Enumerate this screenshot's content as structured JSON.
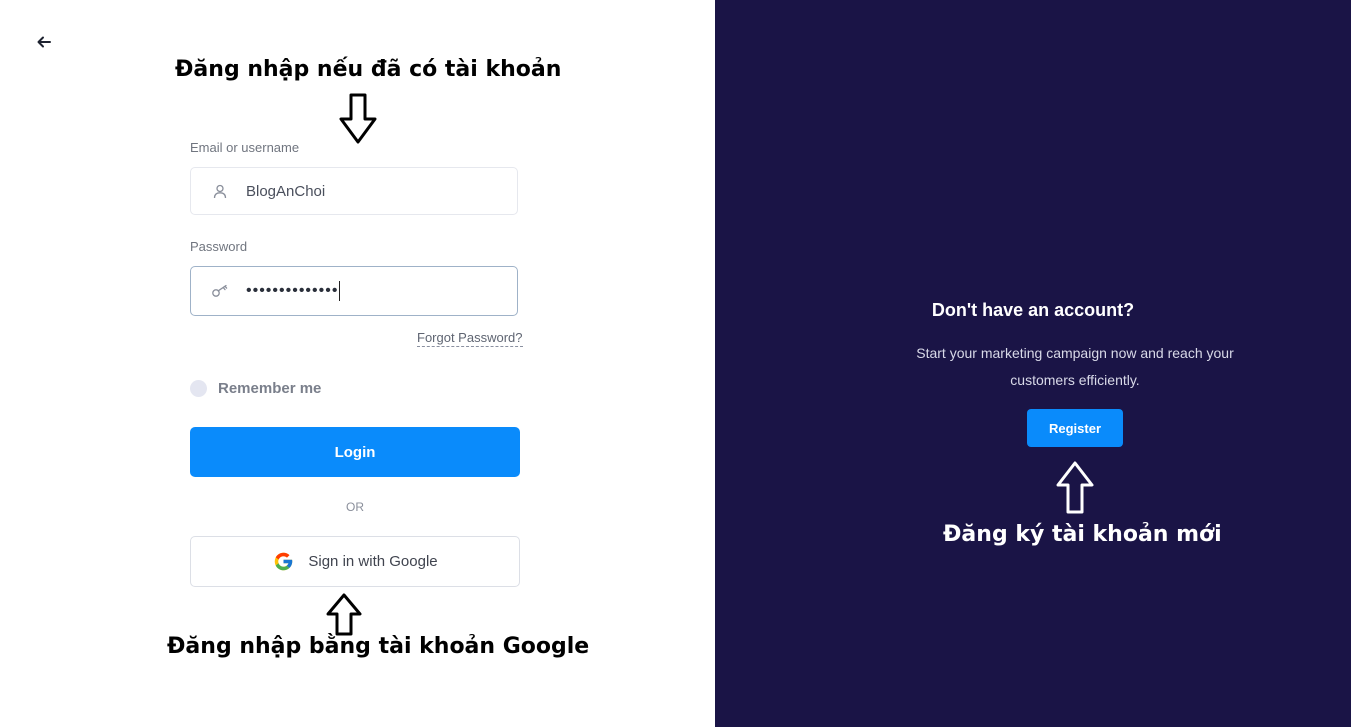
{
  "annotations": {
    "login_hint": "Đăng nhập nếu đã có tài khoản",
    "google_hint": "Đăng nhập bằng tài khoản Google",
    "register_hint": "Đăng ký tài khoản mới"
  },
  "login_form": {
    "email_label": "Email or username",
    "email_value": "BlogAnChoi",
    "password_label": "Password",
    "password_value": "••••••••••••••",
    "forgot_label": "Forgot Password?",
    "remember_label": "Remember me",
    "login_label": "Login",
    "or_label": "OR",
    "google_label": "Sign in with Google"
  },
  "register_panel": {
    "title": "Don't have an account?",
    "description": "Start your marketing campaign now and reach your customers efficiently.",
    "register_label": "Register"
  },
  "colors": {
    "primary": "#0a8bfb",
    "panel_background": "#1a1446"
  },
  "icons": {
    "back": "arrow-left-icon",
    "user": "user-icon",
    "key": "key-icon",
    "google": "google-logo-icon"
  }
}
